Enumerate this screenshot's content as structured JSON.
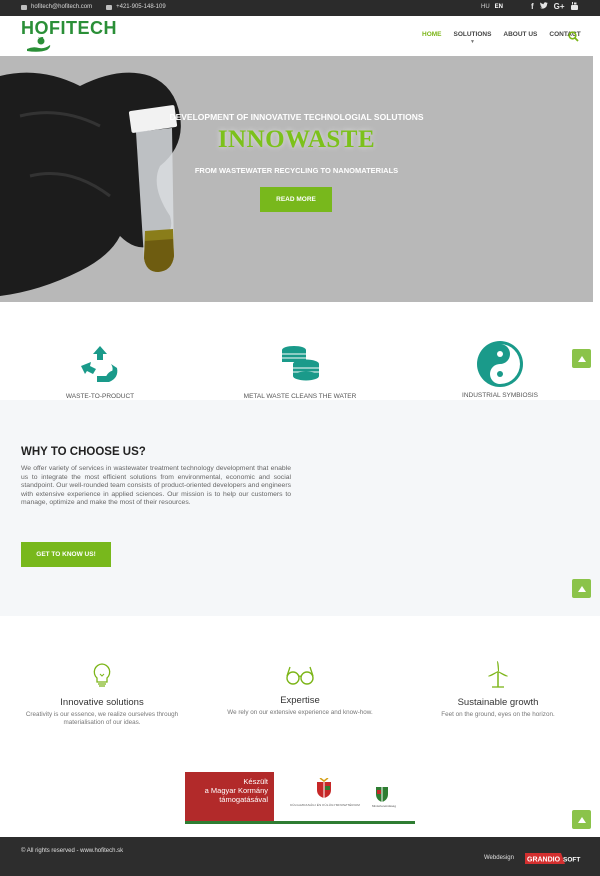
{
  "topbar": {
    "email": "hofitech@hofitech.com",
    "phone": "+421-905-148-109",
    "languages": [
      "HU",
      "EN"
    ],
    "active_language": "EN",
    "social_icons": [
      "facebook-icon",
      "twitter-icon",
      "google-plus-icon",
      "youtube-icon"
    ]
  },
  "header": {
    "logo_text": "HOFITECH",
    "nav": [
      {
        "label": "HOME",
        "active": true
      },
      {
        "label": "SOLUTIONS",
        "active": false
      },
      {
        "label": "ABOUT US",
        "active": false
      },
      {
        "label": "CONTACT",
        "active": false
      }
    ]
  },
  "hero": {
    "subtitle": "DEVELOPMENT OF INNOVATIVE TECHNOLOGIAL SOLUTIONS",
    "title": "INNOWASTE",
    "tagline": "FROM WASTEWATER RECYCLING TO NANOMATERIALS",
    "button": "READ MORE"
  },
  "features": [
    {
      "label": "WASTE-TO-PRODUCT",
      "icon": "recycle-icon"
    },
    {
      "label": "METAL WASTE CLEANS THE WATER",
      "icon": "coins-icon"
    },
    {
      "label": "INDUSTRIAL SYMBIOSIS",
      "icon": "yin-yang-icon"
    }
  ],
  "why": {
    "title": "WHY TO CHOOSE US?",
    "text": "We offer variety of services in wastewater treatment technology development that enable us to integrate the most efficient solutions from environmental, economic and social standpoint. Our well-rounded team consists of product-oriented developers and engineers with extensive experience in applied sciences. Our mission is to help our customers to manage, optimize and make the most of their resources.",
    "button": "GET TO KNOW US!"
  },
  "values": [
    {
      "title": "Innovative solutions",
      "text": "Creativity is our essence, we realize ourselves through materialisation of our ideas.",
      "icon": "lightbulb-icon"
    },
    {
      "title": "Expertise",
      "text": "We rely on our extensive experience and know-how.",
      "icon": "glasses-icon"
    },
    {
      "title": "Sustainable growth",
      "text": "Feet on the ground, eyes on the horizon.",
      "icon": "wind-turbine-icon"
    }
  ],
  "gov_banner": {
    "red_text_1": "Készült",
    "red_text_2": "a Magyar Kormány",
    "red_text_3": "támogatásával",
    "ministry": "KÜLGAZDASÁGI ÉS KÜLÜGYMINISZTÉRIUM",
    "pm": "Miniszterelnökség"
  },
  "footer": {
    "copyright": "© All rights reserved - www.hofitech.sk",
    "webdesign": "Webdesign",
    "brand": "GRANDIO SOFT"
  },
  "colors": {
    "accent": "#7cb518",
    "dark": "#2b2b2b",
    "teal": "#1a9a8a"
  }
}
